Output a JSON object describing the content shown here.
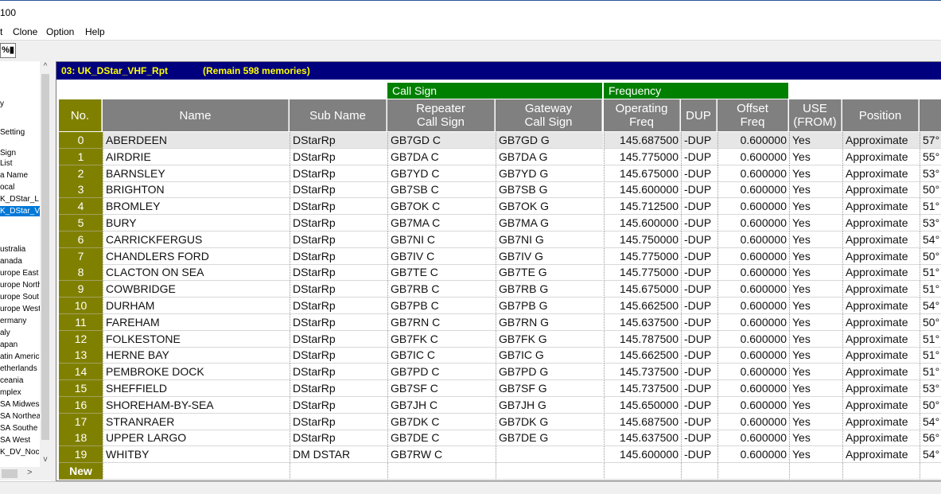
{
  "window": {
    "title": "100"
  },
  "menu": [
    "t",
    "Clone",
    "Option",
    "Help"
  ],
  "toolbar": {
    "icon_glyph": "%▮"
  },
  "tree": {
    "items": [
      {
        "label": "y",
        "selected": false
      },
      {
        "label": "Setting",
        "selected": false
      },
      {
        "label": "Sign",
        "selected": false
      },
      {
        "label": "List",
        "selected": false
      },
      {
        "label": "a Name",
        "selected": false
      },
      {
        "label": "ocal",
        "selected": false
      },
      {
        "label": "K_DStar_L",
        "selected": false
      },
      {
        "label": "K_DStar_V",
        "selected": true
      },
      {
        "label": "ustralia",
        "selected": false
      },
      {
        "label": "anada",
        "selected": false
      },
      {
        "label": "urope East",
        "selected": false
      },
      {
        "label": "urope North",
        "selected": false
      },
      {
        "label": "urope Sout",
        "selected": false
      },
      {
        "label": "urope West",
        "selected": false
      },
      {
        "label": "ermany",
        "selected": false
      },
      {
        "label": "aly",
        "selected": false
      },
      {
        "label": "apan",
        "selected": false
      },
      {
        "label": "atin America",
        "selected": false
      },
      {
        "label": "etherlands",
        "selected": false
      },
      {
        "label": "ceania",
        "selected": false
      },
      {
        "label": "mplex",
        "selected": false
      },
      {
        "label": "SA Midwes",
        "selected": false
      },
      {
        "label": "SA Northea",
        "selected": false
      },
      {
        "label": "SA Southe",
        "selected": false
      },
      {
        "label": "SA West",
        "selected": false
      },
      {
        "label": "K_DV_Noc",
        "selected": false
      }
    ]
  },
  "info": {
    "channel": "03: UK_DStar_VHF_Rpt",
    "remain": "(Remain 598 memories)"
  },
  "groups": {
    "call_sign": "Call Sign",
    "frequency": "Frequency"
  },
  "columns": {
    "no": "No.",
    "name": "Name",
    "sub_name": "Sub Name",
    "rpt_call": "Repeater\nCall Sign",
    "gw_call": "Gateway\nCall Sign",
    "op_freq": "Operating\nFreq",
    "dup": "DUP",
    "offset": "Offset\nFreq",
    "use": "USE\n(FROM)",
    "position": "Position"
  },
  "rows": [
    {
      "no": "0",
      "name": "ABERDEEN",
      "sub": "DStarRp",
      "rpt": "GB7GD  C",
      "gw": "GB7GD  G",
      "freq": "145.687500",
      "dup": "-DUP",
      "offset": "0.600000",
      "use": "Yes",
      "pos": "Approximate",
      "lat": "57°"
    },
    {
      "no": "1",
      "name": "AIRDRIE",
      "sub": "DStarRp",
      "rpt": "GB7DA  C",
      "gw": "GB7DA  G",
      "freq": "145.775000",
      "dup": "-DUP",
      "offset": "0.600000",
      "use": "Yes",
      "pos": "Approximate",
      "lat": "55°"
    },
    {
      "no": "2",
      "name": "BARNSLEY",
      "sub": "DStarRp",
      "rpt": "GB7YD  C",
      "gw": "GB7YD  G",
      "freq": "145.675000",
      "dup": "-DUP",
      "offset": "0.600000",
      "use": "Yes",
      "pos": "Approximate",
      "lat": "53°"
    },
    {
      "no": "3",
      "name": "BRIGHTON",
      "sub": "DStarRp",
      "rpt": "GB7SB  C",
      "gw": "GB7SB  G",
      "freq": "145.600000",
      "dup": "-DUP",
      "offset": "0.600000",
      "use": "Yes",
      "pos": "Approximate",
      "lat": "50°"
    },
    {
      "no": "4",
      "name": "BROMLEY",
      "sub": "DStarRp",
      "rpt": "GB7OK  C",
      "gw": "GB7OK  G",
      "freq": "145.712500",
      "dup": "-DUP",
      "offset": "0.600000",
      "use": "Yes",
      "pos": "Approximate",
      "lat": "51°"
    },
    {
      "no": "5",
      "name": "BURY",
      "sub": "DStarRp",
      "rpt": "GB7MA  C",
      "gw": "GB7MA  G",
      "freq": "145.600000",
      "dup": "-DUP",
      "offset": "0.600000",
      "use": "Yes",
      "pos": "Approximate",
      "lat": "53°"
    },
    {
      "no": "6",
      "name": "CARRICKFERGUS",
      "sub": "DStarRp",
      "rpt": "GB7NI  C",
      "gw": "GB7NI  G",
      "freq": "145.750000",
      "dup": "-DUP",
      "offset": "0.600000",
      "use": "Yes",
      "pos": "Approximate",
      "lat": "54°"
    },
    {
      "no": "7",
      "name": "CHANDLERS FORD",
      "sub": "DStarRp",
      "rpt": "GB7IV  C",
      "gw": "GB7IV  G",
      "freq": "145.775000",
      "dup": "-DUP",
      "offset": "0.600000",
      "use": "Yes",
      "pos": "Approximate",
      "lat": "50°"
    },
    {
      "no": "8",
      "name": "CLACTON ON SEA",
      "sub": "DStarRp",
      "rpt": "GB7TE  C",
      "gw": "GB7TE  G",
      "freq": "145.775000",
      "dup": "-DUP",
      "offset": "0.600000",
      "use": "Yes",
      "pos": "Approximate",
      "lat": "51°"
    },
    {
      "no": "9",
      "name": "COWBRIDGE",
      "sub": "DStarRp",
      "rpt": "GB7RB  C",
      "gw": "GB7RB  G",
      "freq": "145.675000",
      "dup": "-DUP",
      "offset": "0.600000",
      "use": "Yes",
      "pos": "Approximate",
      "lat": "51°"
    },
    {
      "no": "10",
      "name": "DURHAM",
      "sub": "DStarRp",
      "rpt": "GB7PB  C",
      "gw": "GB7PB  G",
      "freq": "145.662500",
      "dup": "-DUP",
      "offset": "0.600000",
      "use": "Yes",
      "pos": "Approximate",
      "lat": "54°"
    },
    {
      "no": "11",
      "name": "FAREHAM",
      "sub": "DStarRp",
      "rpt": "GB7RN  C",
      "gw": "GB7RN  G",
      "freq": "145.637500",
      "dup": "-DUP",
      "offset": "0.600000",
      "use": "Yes",
      "pos": "Approximate",
      "lat": "50°"
    },
    {
      "no": "12",
      "name": "FOLKESTONE",
      "sub": "DStarRp",
      "rpt": "GB7FK  C",
      "gw": "GB7FK  G",
      "freq": "145.787500",
      "dup": "-DUP",
      "offset": "0.600000",
      "use": "Yes",
      "pos": "Approximate",
      "lat": "51°"
    },
    {
      "no": "13",
      "name": "HERNE BAY",
      "sub": "DStarRp",
      "rpt": "GB7IC  C",
      "gw": "GB7IC  G",
      "freq": "145.662500",
      "dup": "-DUP",
      "offset": "0.600000",
      "use": "Yes",
      "pos": "Approximate",
      "lat": "51°"
    },
    {
      "no": "14",
      "name": "PEMBROKE DOCK",
      "sub": "DStarRp",
      "rpt": "GB7PD  C",
      "gw": "GB7PD  G",
      "freq": "145.737500",
      "dup": "-DUP",
      "offset": "0.600000",
      "use": "Yes",
      "pos": "Approximate",
      "lat": "51°"
    },
    {
      "no": "15",
      "name": "SHEFFIELD",
      "sub": "DStarRp",
      "rpt": "GB7SF  C",
      "gw": "GB7SF  G",
      "freq": "145.737500",
      "dup": "-DUP",
      "offset": "0.600000",
      "use": "Yes",
      "pos": "Approximate",
      "lat": "53°"
    },
    {
      "no": "16",
      "name": "SHOREHAM-BY-SEA",
      "sub": "DStarRp",
      "rpt": "GB7JH  C",
      "gw": "GB7JH  G",
      "freq": "145.650000",
      "dup": "-DUP",
      "offset": "0.600000",
      "use": "Yes",
      "pos": "Approximate",
      "lat": "50°"
    },
    {
      "no": "17",
      "name": "STRANRAER",
      "sub": "DStarRp",
      "rpt": "GB7DK  C",
      "gw": "GB7DK  G",
      "freq": "145.687500",
      "dup": "-DUP",
      "offset": "0.600000",
      "use": "Yes",
      "pos": "Approximate",
      "lat": "54°"
    },
    {
      "no": "18",
      "name": "UPPER LARGO",
      "sub": "DStarRp",
      "rpt": "GB7DE  C",
      "gw": "GB7DE  G",
      "freq": "145.637500",
      "dup": "-DUP",
      "offset": "0.600000",
      "use": "Yes",
      "pos": "Approximate",
      "lat": "56°"
    },
    {
      "no": "19",
      "name": "WHITBY",
      "sub": "DM DSTAR",
      "rpt": "GB7RW  C",
      "gw": "",
      "freq": "145.600000",
      "dup": "-DUP",
      "offset": "0.600000",
      "use": "Yes",
      "pos": "Approximate",
      "lat": "54°"
    },
    {
      "no": "New",
      "name": "",
      "sub": "",
      "rpt": "",
      "gw": "",
      "freq": "",
      "dup": "",
      "offset": "",
      "use": "",
      "pos": "",
      "lat": ""
    }
  ],
  "colors": {
    "info_bar_bg": "#00007f",
    "info_bar_text": "#ffff00",
    "group_header": "#008000",
    "column_header": "#808080",
    "no_column": "#808000",
    "tree_selected": "#0078d7"
  }
}
